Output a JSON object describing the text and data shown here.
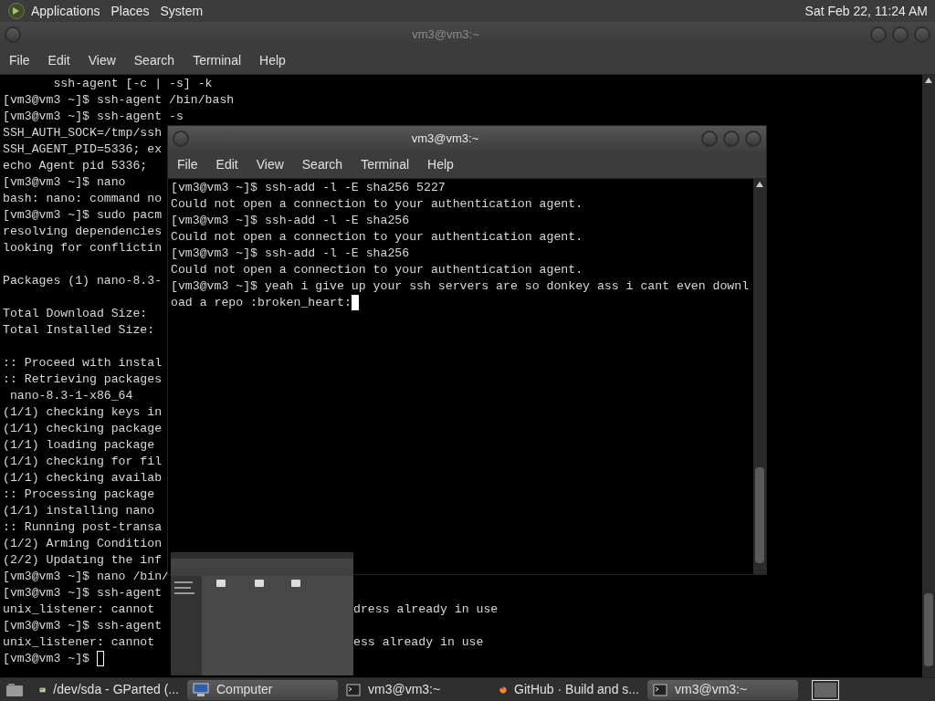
{
  "top_panel": {
    "menus": [
      "Applications",
      "Places",
      "System"
    ],
    "clock": "Sat Feb 22, 11:24 AM"
  },
  "windows": [
    {
      "title": "vm3@vm3:~",
      "active": false,
      "menu": [
        "File",
        "Edit",
        "View",
        "Search",
        "Terminal",
        "Help"
      ],
      "terminal": {
        "blocks": [
          {
            "lines": [
              {
                "text": "       ssh-agent [-c | -s] -k"
              },
              {
                "text": "[vm3@vm3 ~]$ ssh-agent /bin/bash"
              },
              {
                "text": "[vm3@vm3 ~]$ ssh-agent -s"
              },
              {
                "text": "SSH_AUTH_SOCK=/tmp/ssh"
              },
              {
                "text": "SSH_AGENT_PID=5336; ex"
              },
              {
                "text": "echo Agent pid 5336;"
              },
              {
                "text": "[vm3@vm3 ~]$ nano"
              },
              {
                "text": "bash: nano: command no"
              },
              {
                "text": "[vm3@vm3 ~]$ sudo pacm"
              },
              {
                "text": "resolving dependencies"
              },
              {
                "text": "looking for conflictin"
              }
            ]
          },
          {
            "lines": [
              {
                "text": "Packages (1) nano-8.3-"
              }
            ]
          },
          {
            "lines": [
              {
                "text": "Total Download Size:"
              },
              {
                "text": "Total Installed Size:"
              }
            ]
          },
          {
            "lines": [
              {
                "text": ":: Proceed with instal"
              },
              {
                "text": ":: Retrieving packages"
              },
              {
                "text": " nano-8.3-1-x86_64"
              },
              {
                "text": "(1/1) checking keys in"
              },
              {
                "text": "(1/1) checking package"
              },
              {
                "text": "(1/1) loading package"
              },
              {
                "text": "(1/1) checking for fil"
              },
              {
                "text": "(1/1) checking availab"
              },
              {
                "text": ":: Processing package"
              },
              {
                "text": "(1/1) installing nano"
              },
              {
                "text": ":: Running post-transa"
              },
              {
                "text": "(1/2) Arming Condition"
              },
              {
                "text": "(2/2) Updating the inf"
              },
              {
                "text": "[vm3@vm3 ~]$ nano /bin/"
              },
              {
                "text": "[vm3@vm3 ~]$ ssh-agent"
              },
              {
                "text": "unix_listener: cannot",
                "right": "dress already in use"
              },
              {
                "text": "[vm3@vm3 ~]$ ssh-agent"
              },
              {
                "text": "unix_listener: cannot",
                "right": "ess already in use"
              },
              {
                "text": "[vm3@vm3 ~]$"
              }
            ]
          }
        ],
        "focused": false
      }
    },
    {
      "title": "vm3@vm3:~",
      "active": true,
      "menu": [
        "File",
        "Edit",
        "View",
        "Search",
        "Terminal",
        "Help"
      ],
      "terminal": {
        "blocks": [
          {
            "lines": [
              {
                "text": "[vm3@vm3 ~]$ ssh-add -l -E sha256 5227"
              },
              {
                "text": "Could not open a connection to your authentication agent."
              },
              {
                "text": "[vm3@vm3 ~]$ ssh-add -l -E sha256"
              },
              {
                "text": "Could not open a connection to your authentication agent."
              },
              {
                "text": "[vm3@vm3 ~]$ ssh-add -l -E sha256"
              },
              {
                "text": "Could not open a connection to your authentication agent."
              },
              {
                "text": "[vm3@vm3 ~]$ yeah i give up your ssh servers are so donkey ass i cant even downl"
              },
              {
                "text": "oad a repo :broken_heart:"
              }
            ]
          }
        ],
        "focused": true
      }
    }
  ],
  "taskbar": {
    "items": [
      {
        "kind": "disk",
        "label": "/dev/sda - GParted (...",
        "selected": false
      },
      {
        "kind": "computer",
        "label": "Computer",
        "selected": true
      },
      {
        "kind": "terminal",
        "label": "vm3@vm3:~",
        "selected": false
      },
      {
        "kind": "browser",
        "label": "GitHub · Build and s...",
        "selected": false
      },
      {
        "kind": "terminal",
        "label": "vm3@vm3:~",
        "selected": true
      }
    ]
  }
}
